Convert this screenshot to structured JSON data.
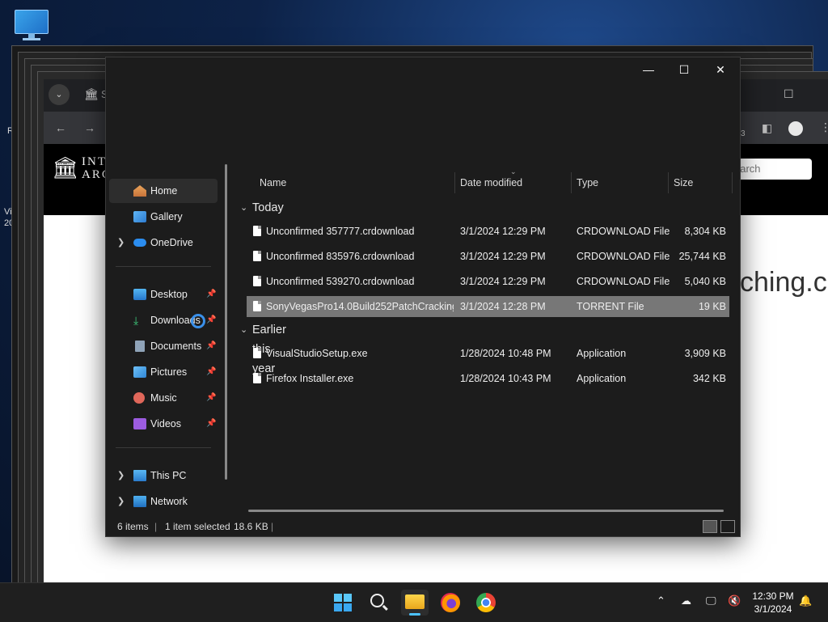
{
  "desktop": {
    "icon": "this-pc-icon",
    "edge_text_1": "R",
    "edge_text_2": "Vi",
    "edge_text_3": "20"
  },
  "browser": {
    "tab_fragment": "S",
    "logo_line1": "INT",
    "logo_line2": "ARC",
    "search_placeholder": "earch",
    "badge_count": "3",
    "page_text_fragment": "ching.c"
  },
  "explorer": {
    "window_controls": {
      "minimize": "—",
      "maximize": "☐",
      "close": "✕"
    },
    "sidebar": {
      "items": [
        {
          "label": "Home",
          "icon": "home-icon",
          "active": true
        },
        {
          "label": "Gallery",
          "icon": "gallery-icon"
        },
        {
          "label": "OneDrive",
          "icon": "cloud-icon",
          "expandable": true
        },
        {
          "label": "Desktop",
          "icon": "desktop-icon",
          "pinned": true
        },
        {
          "label": "Downloads",
          "icon": "download-icon",
          "pinned": true
        },
        {
          "label": "Documents",
          "icon": "documents-icon",
          "pinned": true
        },
        {
          "label": "Pictures",
          "icon": "pictures-icon",
          "pinned": true
        },
        {
          "label": "Music",
          "icon": "music-icon",
          "pinned": true
        },
        {
          "label": "Videos",
          "icon": "videos-icon",
          "pinned": true
        },
        {
          "label": "This PC",
          "icon": "this-pc-icon",
          "expandable": true
        },
        {
          "label": "Network",
          "icon": "network-icon",
          "expandable": true
        }
      ]
    },
    "columns": {
      "name": "Name",
      "date": "Date modified",
      "type": "Type",
      "size": "Size"
    },
    "groups": [
      {
        "label": "Today",
        "files": [
          {
            "name": "Unconfirmed 357777.crdownload",
            "date": "3/1/2024 12:29 PM",
            "type": "CRDOWNLOAD File",
            "size": "8,304 KB"
          },
          {
            "name": "Unconfirmed 835976.crdownload",
            "date": "3/1/2024 12:29 PM",
            "type": "CRDOWNLOAD File",
            "size": "25,744 KB"
          },
          {
            "name": "Unconfirmed 539270.crdownload",
            "date": "3/1/2024 12:29 PM",
            "type": "CRDOWNLOAD File",
            "size": "5,040 KB"
          },
          {
            "name": "SonyVegasPro14.0Build252PatchCracking...",
            "date": "3/1/2024 12:28 PM",
            "type": "TORRENT File",
            "size": "19 KB",
            "selected": true
          }
        ]
      },
      {
        "label": "Earlier this year",
        "files": [
          {
            "name": "VisualStudioSetup.exe",
            "date": "1/28/2024 10:48 PM",
            "type": "Application",
            "size": "3,909 KB"
          },
          {
            "name": "Firefox Installer.exe",
            "date": "1/28/2024 10:43 PM",
            "type": "Application",
            "size": "342 KB"
          }
        ]
      }
    ],
    "status": {
      "count": "6 items",
      "selection": "1 item selected",
      "size": "18.6 KB"
    }
  },
  "taskbar": {
    "apps": [
      "start-icon",
      "search-icon",
      "file-explorer-icon",
      "firefox-icon",
      "chrome-icon"
    ],
    "clock_time": "12:30 PM",
    "clock_date": "3/1/2024"
  }
}
